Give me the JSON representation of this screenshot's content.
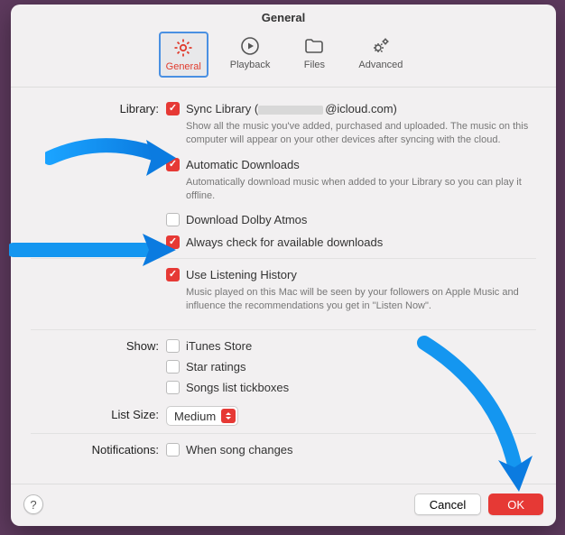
{
  "window": {
    "title": "General"
  },
  "toolbar": {
    "items": [
      {
        "name": "general",
        "label": "General",
        "selected": true
      },
      {
        "name": "playback",
        "label": "Playback",
        "selected": false
      },
      {
        "name": "files",
        "label": "Files",
        "selected": false
      },
      {
        "name": "advanced",
        "label": "Advanced",
        "selected": false
      }
    ]
  },
  "sections": {
    "library": {
      "label": "Library:",
      "sync": {
        "checked": true,
        "label_prefix": "Sync Library (",
        "email_suffix": "@icloud.com)",
        "desc": "Show all the music you've added, purchased and uploaded. The music on this computer will appear on your other devices after syncing with the cloud."
      },
      "auto_downloads": {
        "checked": true,
        "label": "Automatic Downloads",
        "desc": "Automatically download music when added to your Library so you can play it offline."
      },
      "dolby": {
        "checked": false,
        "label": "Download Dolby Atmos"
      },
      "always_check": {
        "checked": true,
        "label": "Always check for available downloads"
      },
      "listening_history": {
        "checked": true,
        "label": "Use Listening History",
        "desc": "Music played on this Mac will be seen by your followers on Apple Music and influence the recommendations you get in \"Listen Now\"."
      }
    },
    "show": {
      "label": "Show:",
      "itunes_store": {
        "checked": false,
        "label": "iTunes Store"
      },
      "star_ratings": {
        "checked": false,
        "label": "Star ratings"
      },
      "tickboxes": {
        "checked": false,
        "label": "Songs list tickboxes"
      }
    },
    "list_size": {
      "label": "List Size:",
      "value": "Medium"
    },
    "notifications": {
      "label": "Notifications:",
      "song_changes": {
        "checked": false,
        "label": "When song changes"
      }
    }
  },
  "footer": {
    "help": "?",
    "cancel": "Cancel",
    "ok": "OK"
  }
}
